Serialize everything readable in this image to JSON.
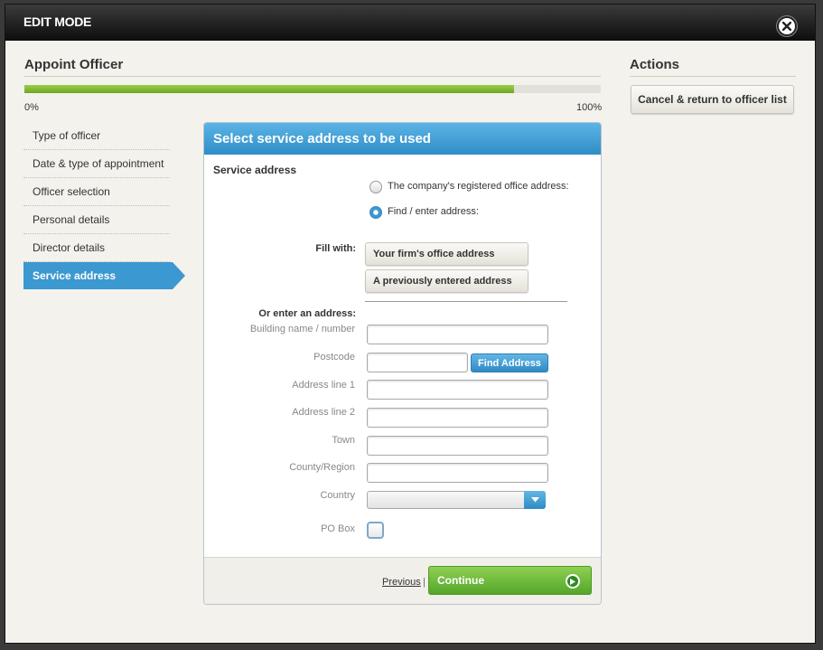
{
  "window": {
    "title": "EDIT MODE",
    "close_icon": "close-icon"
  },
  "page": {
    "title": "Appoint Officer"
  },
  "progress": {
    "value_percent": 85,
    "min_label": "0%",
    "max_label": "100%"
  },
  "actions": {
    "title": "Actions",
    "cancel_label": "Cancel & return to officer list"
  },
  "steps": [
    {
      "label": "Type of officer"
    },
    {
      "label": "Date & type of appointment"
    },
    {
      "label": "Officer selection"
    },
    {
      "label": "Personal details"
    },
    {
      "label": "Director details"
    },
    {
      "label": "Service address"
    }
  ],
  "panel": {
    "title": "Select service address to be used",
    "service_address_label": "Service address",
    "radio_registered": "The company's registered office address:",
    "radio_find": "Find / enter address:",
    "fill_with_label": "Fill with:",
    "btn_firm": "Your firm's office address",
    "btn_previous": "A previously entered address",
    "or_enter_label": "Or enter an address:",
    "fields": {
      "building": "Building name / number",
      "postcode": "Postcode",
      "find_button": "Find Address",
      "line1": "Address line 1",
      "line2": "Address line 2",
      "town": "Town",
      "county": "County/Region",
      "country": "Country",
      "pobox": "PO Box"
    },
    "footer": {
      "previous": "Previous",
      "separator": "|",
      "continue": "Continue"
    }
  },
  "colors": {
    "accent": "#3b98d0",
    "progress": "#7fb935",
    "continue": "#6db83a"
  }
}
